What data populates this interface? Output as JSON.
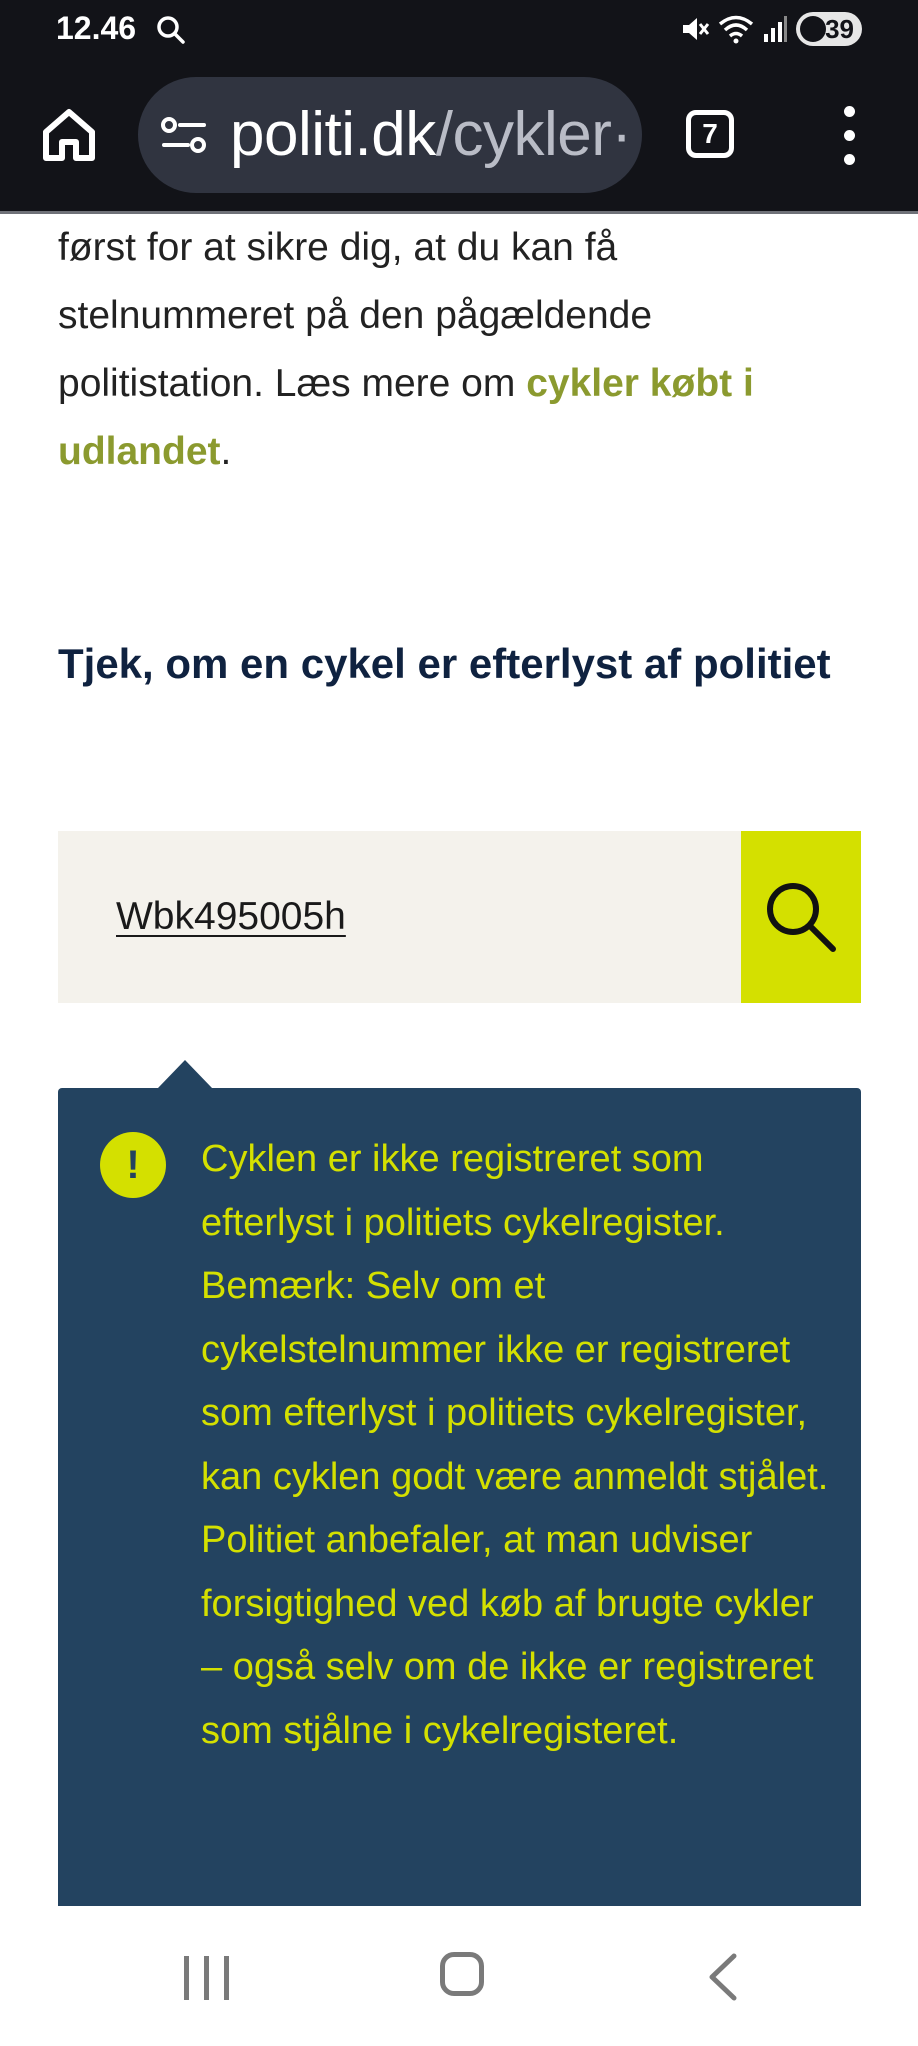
{
  "status_bar": {
    "time": "12.46",
    "battery": "39",
    "icons": [
      "search-icon",
      "mute-icon",
      "wifi-icon",
      "signal-icon",
      "battery-icon"
    ]
  },
  "browser": {
    "url_domain": "politi.dk",
    "url_path": "/cykler·",
    "tab_count": "7",
    "icons": [
      "home-icon",
      "site-info-icon",
      "more-vert-icon"
    ]
  },
  "content": {
    "intro_lines": [
      "først for at sikre dig, at du kan få",
      "stelnummeret på den pågældende",
      "politistation. Læs mere om "
    ],
    "intro_link": "cykler købt i udlandet",
    "intro_end": ".",
    "heading": "Tjek, om en cykel er efterlyst af politiet",
    "search": {
      "value": "Wbk495005h",
      "button_icon": "search-icon"
    },
    "notice": {
      "icon": "!",
      "text": "Cyklen er ikke registreret som efterlyst i politiets cykelregister. Bemærk: Selv om et cykelstelnummer ikke er registreret som efterlyst i politiets cykelregister, kan cyklen godt være anmeldt stjålet. Politiet anbefaler, at man udviser forsigtighed ved køb af brugte cykler – også selv om de ikke er registreret som stjålne i cykelregisteret."
    }
  },
  "nav_bar": {
    "icons": [
      "recent-apps-icon",
      "home-icon",
      "back-icon"
    ]
  },
  "colors": {
    "accent_lime": "#d4e000",
    "notice_bg": "#234360",
    "link": "#8b9a2f",
    "heading": "#0f2240"
  }
}
